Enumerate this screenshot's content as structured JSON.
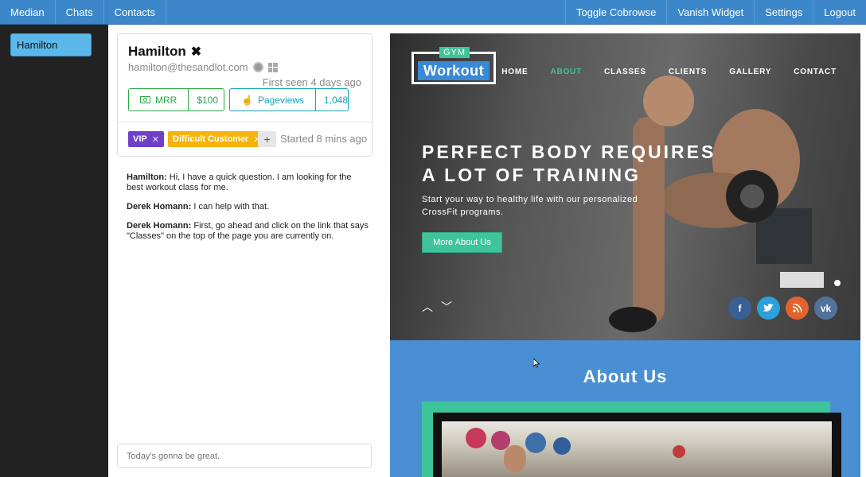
{
  "topbar": {
    "left": [
      "Median",
      "Chats",
      "Contacts"
    ],
    "right": [
      "Toggle Cobrowse",
      "Vanish Widget",
      "Settings",
      "Logout"
    ]
  },
  "sidebar": {
    "items": [
      {
        "label": "Hamilton"
      }
    ]
  },
  "visitor": {
    "name": "Hamilton",
    "email": "hamilton@thesandlot.com",
    "first_seen": "First seen 4 days ago",
    "stats": [
      {
        "label": "MRR",
        "value": "$100"
      },
      {
        "label": "Pageviews",
        "value": "1,048"
      }
    ],
    "tags": [
      "VIP",
      "Difficult Customer"
    ],
    "started": "Started 8 mins ago"
  },
  "chat": {
    "messages": [
      {
        "sender": "Hamilton:",
        "text": "Hi, I have a quick question. I am looking for the best workout class for me."
      },
      {
        "sender": "Derek Homann:",
        "text": "I can help with that."
      },
      {
        "sender": "Derek Homann:",
        "text": "First, go ahead and click on the link that says \"Classes\" on the top of the page you are currently on."
      }
    ],
    "input_placeholder": "Today's gonna be great."
  },
  "website": {
    "logo_small": "GYM",
    "logo_main": "Workout",
    "nav": [
      "HOME",
      "ABOUT",
      "CLASSES",
      "CLIENTS",
      "GALLERY",
      "CONTACT"
    ],
    "active_nav": "ABOUT",
    "headline_line1": "PERFECT BODY REQUIRES",
    "headline_line2": "A LOT OF TRAINING",
    "subline": "Start your way to healthy life with our personalized CrossFit programs.",
    "button": "More About Us",
    "social": [
      "f",
      "t",
      "rss",
      "vk"
    ],
    "about_title": "About Us"
  },
  "colors": {
    "topbar": "#3b87c9",
    "sidebar": "#222222",
    "sidebar_active": "#5cb8ea",
    "mrr": "#28a745",
    "pageviews": "#17a2b8",
    "vip_tag": "#6f3fc9",
    "difficult_tag": "#f5b30c",
    "site_accent": "#3ec49a",
    "site_blue": "#4a8fd3"
  }
}
